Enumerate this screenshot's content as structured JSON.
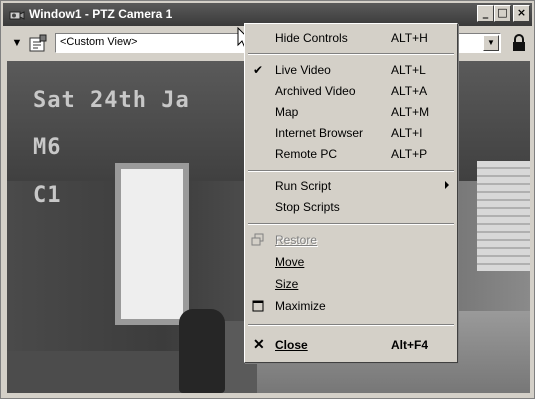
{
  "window": {
    "title": "Window1 - PTZ Camera 1",
    "buttons": {
      "minimize": "_",
      "maximize": "□",
      "close": "×"
    }
  },
  "toolbar": {
    "view_select": "<Custom View>"
  },
  "video": {
    "osd_line1": "Sat 24th Ja",
    "osd_line2": "M6",
    "osd_line3": "C1"
  },
  "menu": {
    "hide_controls": {
      "label": "Hide Controls",
      "shortcut": "ALT+H"
    },
    "live_video": {
      "label": "Live Video",
      "shortcut": "ALT+L",
      "checked": true
    },
    "archived_video": {
      "label": "Archived Video",
      "shortcut": "ALT+A"
    },
    "map": {
      "label": "Map",
      "shortcut": "ALT+M"
    },
    "internet_browser": {
      "label": "Internet Browser",
      "shortcut": "ALT+I"
    },
    "remote_pc": {
      "label": "Remote PC",
      "shortcut": "ALT+P"
    },
    "run_script": {
      "label": "Run Script"
    },
    "stop_scripts": {
      "label": "Stop Scripts"
    },
    "restore": {
      "label": "Restore",
      "enabled": false
    },
    "move": {
      "label": "Move"
    },
    "size": {
      "label": "Size"
    },
    "maximize": {
      "label": "Maximize"
    },
    "close": {
      "label": "Close",
      "shortcut": "Alt+F4"
    }
  }
}
